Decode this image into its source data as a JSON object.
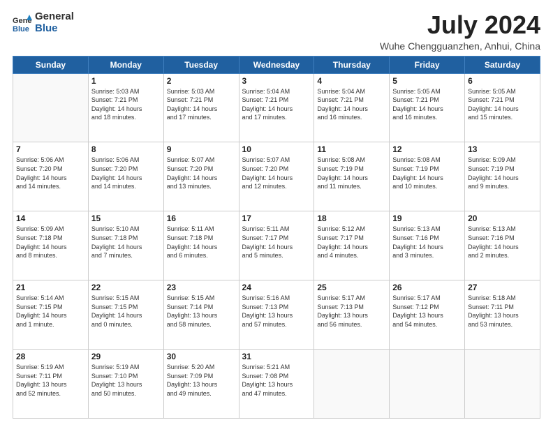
{
  "logo": {
    "general": "General",
    "blue": "Blue"
  },
  "title": {
    "month_year": "July 2024",
    "location": "Wuhe Chengguanzhen, Anhui, China"
  },
  "headers": [
    "Sunday",
    "Monday",
    "Tuesday",
    "Wednesday",
    "Thursday",
    "Friday",
    "Saturday"
  ],
  "weeks": [
    [
      {
        "day": "",
        "info": ""
      },
      {
        "day": "1",
        "info": "Sunrise: 5:03 AM\nSunset: 7:21 PM\nDaylight: 14 hours\nand 18 minutes."
      },
      {
        "day": "2",
        "info": "Sunrise: 5:03 AM\nSunset: 7:21 PM\nDaylight: 14 hours\nand 17 minutes."
      },
      {
        "day": "3",
        "info": "Sunrise: 5:04 AM\nSunset: 7:21 PM\nDaylight: 14 hours\nand 17 minutes."
      },
      {
        "day": "4",
        "info": "Sunrise: 5:04 AM\nSunset: 7:21 PM\nDaylight: 14 hours\nand 16 minutes."
      },
      {
        "day": "5",
        "info": "Sunrise: 5:05 AM\nSunset: 7:21 PM\nDaylight: 14 hours\nand 16 minutes."
      },
      {
        "day": "6",
        "info": "Sunrise: 5:05 AM\nSunset: 7:21 PM\nDaylight: 14 hours\nand 15 minutes."
      }
    ],
    [
      {
        "day": "7",
        "info": "Sunrise: 5:06 AM\nSunset: 7:20 PM\nDaylight: 14 hours\nand 14 minutes."
      },
      {
        "day": "8",
        "info": "Sunrise: 5:06 AM\nSunset: 7:20 PM\nDaylight: 14 hours\nand 14 minutes."
      },
      {
        "day": "9",
        "info": "Sunrise: 5:07 AM\nSunset: 7:20 PM\nDaylight: 14 hours\nand 13 minutes."
      },
      {
        "day": "10",
        "info": "Sunrise: 5:07 AM\nSunset: 7:20 PM\nDaylight: 14 hours\nand 12 minutes."
      },
      {
        "day": "11",
        "info": "Sunrise: 5:08 AM\nSunset: 7:19 PM\nDaylight: 14 hours\nand 11 minutes."
      },
      {
        "day": "12",
        "info": "Sunrise: 5:08 AM\nSunset: 7:19 PM\nDaylight: 14 hours\nand 10 minutes."
      },
      {
        "day": "13",
        "info": "Sunrise: 5:09 AM\nSunset: 7:19 PM\nDaylight: 14 hours\nand 9 minutes."
      }
    ],
    [
      {
        "day": "14",
        "info": "Sunrise: 5:09 AM\nSunset: 7:18 PM\nDaylight: 14 hours\nand 8 minutes."
      },
      {
        "day": "15",
        "info": "Sunrise: 5:10 AM\nSunset: 7:18 PM\nDaylight: 14 hours\nand 7 minutes."
      },
      {
        "day": "16",
        "info": "Sunrise: 5:11 AM\nSunset: 7:18 PM\nDaylight: 14 hours\nand 6 minutes."
      },
      {
        "day": "17",
        "info": "Sunrise: 5:11 AM\nSunset: 7:17 PM\nDaylight: 14 hours\nand 5 minutes."
      },
      {
        "day": "18",
        "info": "Sunrise: 5:12 AM\nSunset: 7:17 PM\nDaylight: 14 hours\nand 4 minutes."
      },
      {
        "day": "19",
        "info": "Sunrise: 5:13 AM\nSunset: 7:16 PM\nDaylight: 14 hours\nand 3 minutes."
      },
      {
        "day": "20",
        "info": "Sunrise: 5:13 AM\nSunset: 7:16 PM\nDaylight: 14 hours\nand 2 minutes."
      }
    ],
    [
      {
        "day": "21",
        "info": "Sunrise: 5:14 AM\nSunset: 7:15 PM\nDaylight: 14 hours\nand 1 minute."
      },
      {
        "day": "22",
        "info": "Sunrise: 5:15 AM\nSunset: 7:15 PM\nDaylight: 14 hours\nand 0 minutes."
      },
      {
        "day": "23",
        "info": "Sunrise: 5:15 AM\nSunset: 7:14 PM\nDaylight: 13 hours\nand 58 minutes."
      },
      {
        "day": "24",
        "info": "Sunrise: 5:16 AM\nSunset: 7:13 PM\nDaylight: 13 hours\nand 57 minutes."
      },
      {
        "day": "25",
        "info": "Sunrise: 5:17 AM\nSunset: 7:13 PM\nDaylight: 13 hours\nand 56 minutes."
      },
      {
        "day": "26",
        "info": "Sunrise: 5:17 AM\nSunset: 7:12 PM\nDaylight: 13 hours\nand 54 minutes."
      },
      {
        "day": "27",
        "info": "Sunrise: 5:18 AM\nSunset: 7:11 PM\nDaylight: 13 hours\nand 53 minutes."
      }
    ],
    [
      {
        "day": "28",
        "info": "Sunrise: 5:19 AM\nSunset: 7:11 PM\nDaylight: 13 hours\nand 52 minutes."
      },
      {
        "day": "29",
        "info": "Sunrise: 5:19 AM\nSunset: 7:10 PM\nDaylight: 13 hours\nand 50 minutes."
      },
      {
        "day": "30",
        "info": "Sunrise: 5:20 AM\nSunset: 7:09 PM\nDaylight: 13 hours\nand 49 minutes."
      },
      {
        "day": "31",
        "info": "Sunrise: 5:21 AM\nSunset: 7:08 PM\nDaylight: 13 hours\nand 47 minutes."
      },
      {
        "day": "",
        "info": ""
      },
      {
        "day": "",
        "info": ""
      },
      {
        "day": "",
        "info": ""
      }
    ]
  ]
}
